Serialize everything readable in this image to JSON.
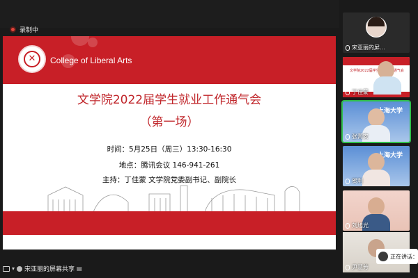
{
  "recording": {
    "label": "录制中"
  },
  "slide": {
    "college": "College of Liberal Arts",
    "title": "文学院2022届学生就业工作通气会",
    "subtitle": "（第一场）",
    "time": "时间：5月25日（周三）13:30-16:30",
    "location": "地点：腾讯会议 146-941-261",
    "host": "主持：丁佳蒙 文学院党委副书记、副院长"
  },
  "share_bar": {
    "label": "宋亚丽的屏幕共享"
  },
  "participants": [
    {
      "name": "宋亚丽的屏...",
      "active": false
    },
    {
      "name": "丁佳蒙",
      "active": false
    },
    {
      "name": "张菁安",
      "active": true
    },
    {
      "name": "贺利",
      "active": false
    },
    {
      "name": "刘旭光",
      "active": false
    },
    {
      "name": "尹慧芳",
      "active": false
    }
  ],
  "thumbnail_texts": {
    "slide_thumb": "文学院2022届学生就业工作通气会",
    "university": "上海大学"
  },
  "speaking_indicator": {
    "label": "正在讲话："
  },
  "colors": {
    "brand_red": "#c81f27",
    "active_green": "#2fbf4a",
    "title_red": "#c0252a"
  }
}
